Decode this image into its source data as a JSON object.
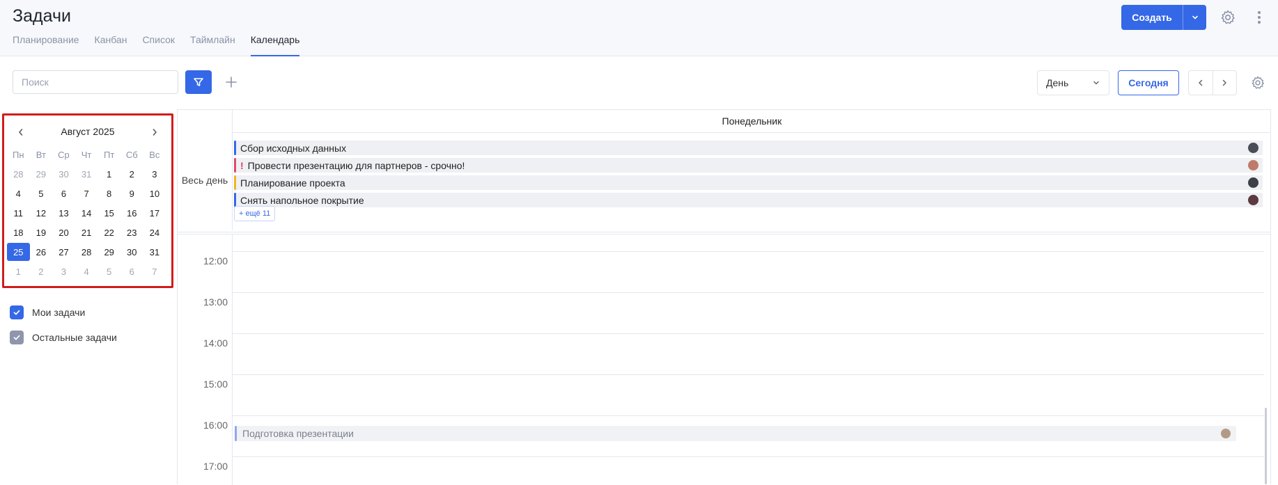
{
  "header": {
    "title": "Задачи",
    "tabs": [
      {
        "label": "Планирование",
        "active": false
      },
      {
        "label": "Канбан",
        "active": false
      },
      {
        "label": "Список",
        "active": false
      },
      {
        "label": "Таймлайн",
        "active": false
      },
      {
        "label": "Календарь",
        "active": true
      }
    ],
    "create_label": "Создать",
    "icons": [
      "chevron-down-icon",
      "gear-icon",
      "more-vertical-icon"
    ]
  },
  "toolbar": {
    "search_placeholder": "Поиск",
    "search_value": "",
    "view_selected": "День",
    "today_label": "Сегодня",
    "icons": [
      "filter-icon",
      "plus-icon",
      "chevron-left-icon",
      "chevron-right-icon",
      "gear-icon"
    ]
  },
  "mini_calendar": {
    "title": "Август 2025",
    "weekdays": [
      "Пн",
      "Вт",
      "Ср",
      "Чт",
      "Пт",
      "Сб",
      "Вс"
    ],
    "weeks": [
      [
        "28",
        "29",
        "30",
        "31",
        "1",
        "2",
        "3"
      ],
      [
        "4",
        "5",
        "6",
        "7",
        "8",
        "9",
        "10"
      ],
      [
        "11",
        "12",
        "13",
        "14",
        "15",
        "16",
        "17"
      ],
      [
        "18",
        "19",
        "20",
        "21",
        "22",
        "23",
        "24"
      ],
      [
        "25",
        "26",
        "27",
        "28",
        "29",
        "30",
        "31"
      ],
      [
        "1",
        "2",
        "3",
        "4",
        "5",
        "6",
        "7"
      ]
    ],
    "selected": "25"
  },
  "filters": [
    {
      "label": "Мои задачи",
      "checked": true,
      "color": "#3568e6"
    },
    {
      "label": "Остальные задачи",
      "checked": true,
      "color": "#8f96ab"
    }
  ],
  "calendar": {
    "day_name": "Понедельник",
    "allday_label": "Весь день",
    "allday_events": [
      {
        "title": "Сбор исходных данных",
        "color": "#3568e6",
        "urgent": false,
        "avatar_color": "#4a4d55"
      },
      {
        "title": "Провести презентацию для партнеров - срочно!",
        "color": "#e04b6e",
        "urgent": true,
        "urgent_mark": "!",
        "avatar_color": "#c07a6c"
      },
      {
        "title": "Планирование проекта",
        "color": "#efb526",
        "urgent": false,
        "avatar_color": "#3e4048"
      },
      {
        "title": "Снять напольное покрытие",
        "color": "#3568e6",
        "urgent": false,
        "avatar_color": "#5b3a40"
      }
    ],
    "more_label": "+ ещё 11",
    "hours": [
      "12:00",
      "13:00",
      "14:00",
      "15:00",
      "16:00",
      "17:00"
    ],
    "timed_events": [
      {
        "title": "Подготовка презентации",
        "hour": "16:00"
      }
    ]
  },
  "colors": {
    "accent": "#3568e6",
    "highlight_border": "#d11c1c"
  }
}
